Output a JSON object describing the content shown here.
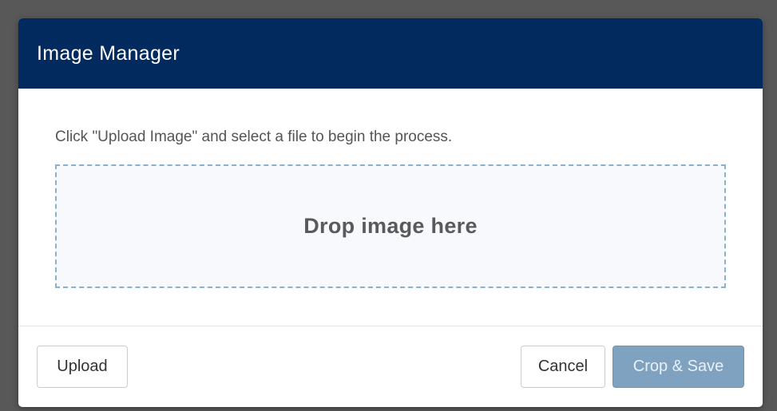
{
  "dialog": {
    "title": "Image Manager",
    "instructions": "Click \"Upload Image\" and select a file to begin the process.",
    "dropzone_label": "Drop image here",
    "buttons": {
      "upload": "Upload",
      "cancel": "Cancel",
      "crop_save": "Crop & Save"
    },
    "crop_save_disabled": true
  },
  "colors": {
    "header_bg": "#022a5e",
    "dropzone_border": "#8ab0cf",
    "primary_disabled": "#7fa2c0"
  }
}
